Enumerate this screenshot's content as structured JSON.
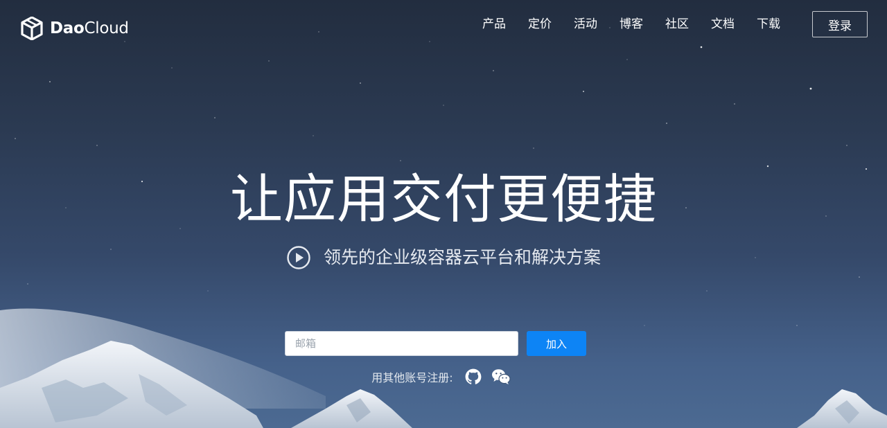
{
  "brand": {
    "name_bold": "Dao",
    "name_regular": "Cloud"
  },
  "nav": {
    "items": [
      "产品",
      "定价",
      "活动",
      "博客",
      "社区",
      "文档",
      "下载"
    ],
    "login_label": "登录"
  },
  "hero": {
    "headline": "让应用交付更便捷",
    "subline": "领先的企业级容器云平台和解决方案"
  },
  "signup": {
    "email_placeholder": "邮箱",
    "join_label": "加入",
    "social_label": "用其他账号注册:"
  },
  "icons": {
    "logo": "daocloud-cube-icon",
    "play": "play-circle-icon",
    "github": "github-icon",
    "wechat": "wechat-icon"
  },
  "colors": {
    "primary_button": "#0d84f5",
    "sky_top": "#222d3f",
    "sky_bottom": "#4c6a92"
  }
}
